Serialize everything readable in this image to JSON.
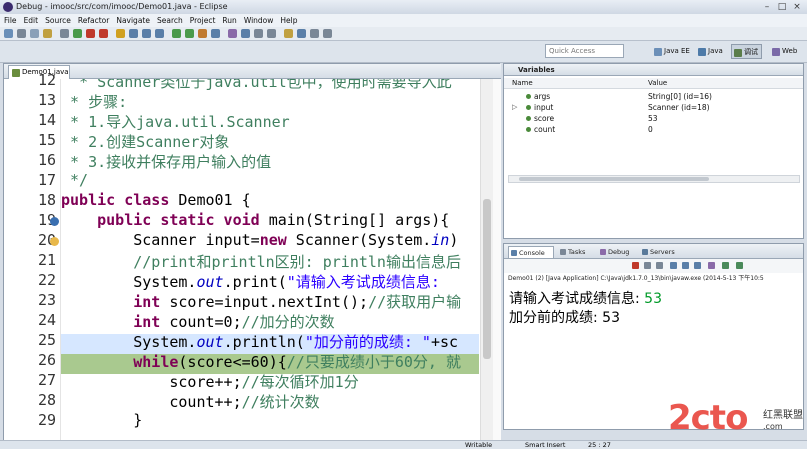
{
  "window": {
    "title": "Debug - imooc/src/com/imooc/Demo01.java - Eclipse"
  },
  "menu": [
    "File",
    "Edit",
    "Source",
    "Refactor",
    "Navigate",
    "Search",
    "Project",
    "Run",
    "Window",
    "Help"
  ],
  "quick_access": {
    "placeholder": "Quick Access"
  },
  "perspectives": [
    {
      "label": "Java EE",
      "color": "#6b8fb8"
    },
    {
      "label": "Java",
      "color": "#4d7aa8"
    },
    {
      "label": "调试",
      "color": "#5a7d4a"
    },
    {
      "label": "Web",
      "color": "#7a6aa8"
    }
  ],
  "editor": {
    "tab_label": "Demo01.java",
    "lines": [
      {
        "n": "12",
        "html": "  <span class='cm'>* Scanner类位于java.util包中，使用时需要导入此</span>"
      },
      {
        "n": "13",
        "html": "<span class='cm'> * 步骤:</span>"
      },
      {
        "n": "14",
        "html": "<span class='cm'> * 1.导入java.util.Scanner</span>"
      },
      {
        "n": "15",
        "html": "<span class='cm'> * 2.创建Scanner对象</span>"
      },
      {
        "n": "16",
        "html": "<span class='cm'> * 3.接收并保存用户输入的值</span>"
      },
      {
        "n": "17",
        "html": "<span class='cm'> */</span>"
      },
      {
        "n": "18",
        "html": "<span class='kw'>public class</span> Demo01 {"
      },
      {
        "n": "19",
        "html": "    <span class='kw'>public static void</span> main(String[] args){"
      },
      {
        "n": "20",
        "html": "        Scanner input=<span class='kw'>new</span> Scanner(System.<span class='fd'>in</span>)"
      },
      {
        "n": "21",
        "html": "        <span class='cm'>//print和println区别: println输出信息后</span>"
      },
      {
        "n": "22",
        "html": "        System.<span class='fd'>out</span>.print(<span class='st'>\"请输入考试成绩信息: </span>"
      },
      {
        "n": "23",
        "html": "        <span class='kw'>int</span> score=input.nextInt();<span class='cm'>//获取用户输</span>"
      },
      {
        "n": "24",
        "html": "        <span class='kw'>int</span> count=0;<span class='cm'>//加分的次数</span>"
      },
      {
        "n": "25",
        "html": "        System.<span class='fd'>out</span>.println(<span class='st'>\"加分前的成绩: \"</span>+sc"
      },
      {
        "n": "26",
        "html": "        <span class='kw'>while</span>(score<=60){<span class='cm'>//只要成绩小于60分, 就</span>"
      },
      {
        "n": "27",
        "html": "            score++;<span class='cm'>//每次循环加1分</span>"
      },
      {
        "n": "28",
        "html": "            count++;<span class='cm'>//统计次数</span>"
      },
      {
        "n": "29",
        "html": "        }"
      }
    ]
  },
  "variables": {
    "tab_label": "Variables",
    "col_name": "Name",
    "col_value": "Value",
    "rows": [
      {
        "name": "args",
        "value": "String[0]  (id=16)",
        "expand": ""
      },
      {
        "name": "input",
        "value": "Scanner  (id=18)",
        "expand": "▷"
      },
      {
        "name": "score",
        "value": "53",
        "expand": ""
      },
      {
        "name": "count",
        "value": "0",
        "expand": ""
      }
    ]
  },
  "console": {
    "tabs": [
      "Console",
      "Tasks",
      "Debug",
      "Servers"
    ],
    "description": "Demo01 (2) [Java Application] C:\\Java\\jdk1.7.0_13\\bin\\javaw.exe (2014-5-13 下午10:5",
    "line1_text": "请输入考试成绩信息: ",
    "line1_value": "53",
    "line2_text": "加分前的成绩: ",
    "line2_value": "53"
  },
  "status": {
    "writable": "Writable",
    "insert": "Smart Insert",
    "position": "25 : 27"
  },
  "watermark": {
    "logo": "2cto",
    "small1": "红黑联盟",
    "small2": ".com"
  }
}
